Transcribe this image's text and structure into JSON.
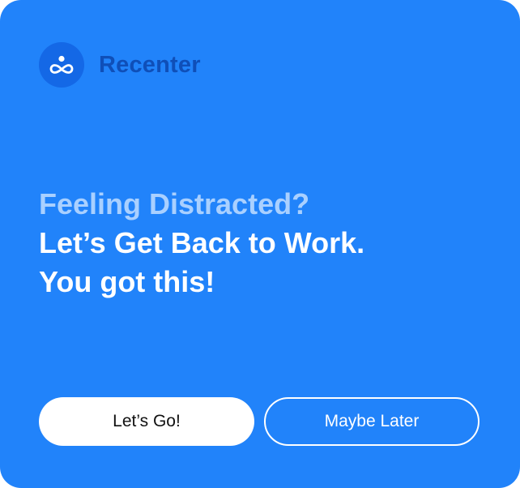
{
  "app": {
    "name": "Recenter",
    "logo_icon": "meditation-infinity-icon"
  },
  "message": {
    "line1": "Feeling Distracted?",
    "line2": "Let’s Get Back to Work.",
    "line3": "You got this!"
  },
  "actions": {
    "primary_label": "Let’s Go!",
    "secondary_label": "Maybe Later"
  },
  "colors": {
    "card_background": "#2183fa",
    "logo_background": "#1468e6",
    "brand_text": "#0f4fb8",
    "muted_text": "#a9d0ff",
    "primary_text": "#ffffff"
  }
}
